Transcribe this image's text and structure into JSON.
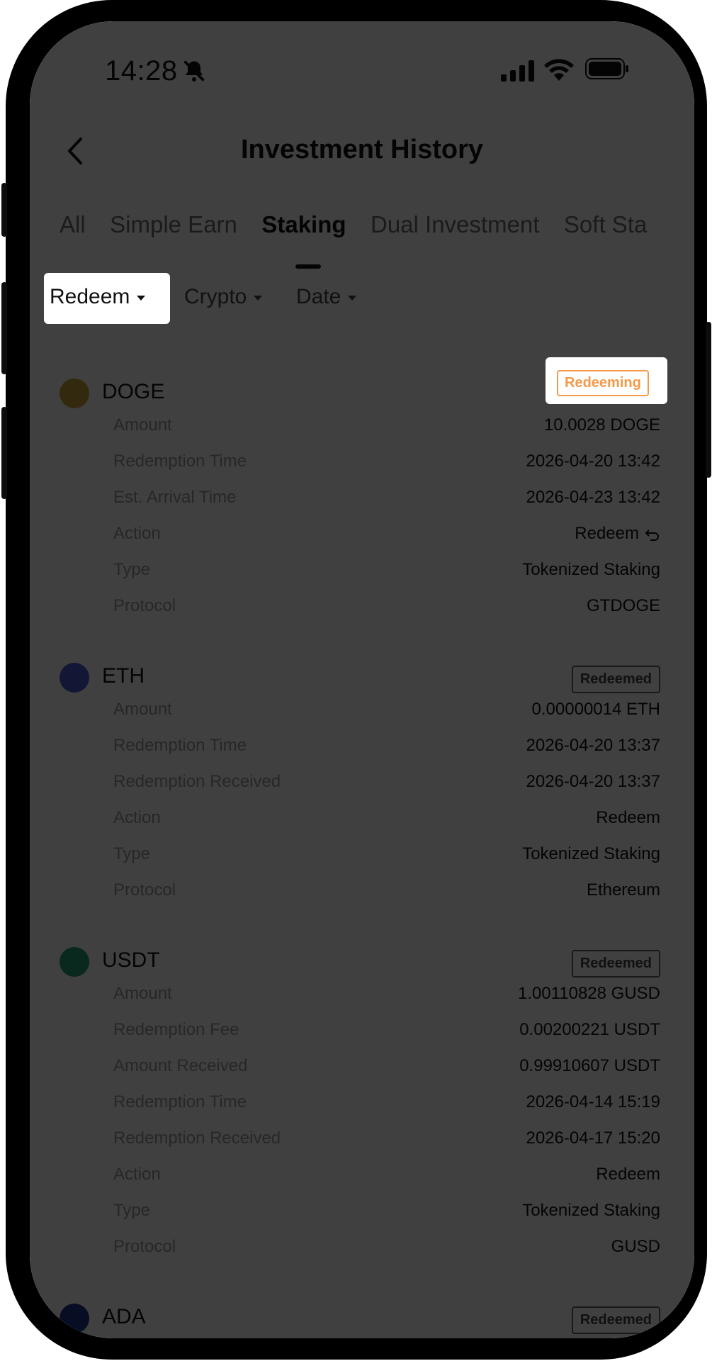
{
  "status_bar": {
    "time": "14:28"
  },
  "header": {
    "title": "Investment History"
  },
  "tabs": [
    {
      "label": "All"
    },
    {
      "label": "Simple Earn"
    },
    {
      "label": "Staking",
      "active": true
    },
    {
      "label": "Dual Investment"
    },
    {
      "label": "Soft Sta"
    }
  ],
  "filters": {
    "type": "Redeem",
    "crypto": "Crypto",
    "date": "Date"
  },
  "records": [
    {
      "coin": "DOGE",
      "status": "Redeeming",
      "rows": [
        {
          "label": "Amount",
          "value": "10.0028 DOGE"
        },
        {
          "label": "Redemption Time",
          "value": "2026-04-20 13:42"
        },
        {
          "label": "Est. Arrival Time",
          "value": "2026-04-23 13:42"
        },
        {
          "label": "Action",
          "value": "Redeem"
        },
        {
          "label": "Type",
          "value": "Tokenized Staking"
        },
        {
          "label": "Protocol",
          "value": "GTDOGE"
        }
      ]
    },
    {
      "coin": "ETH",
      "status": "Redeemed",
      "rows": [
        {
          "label": "Amount",
          "value": "0.00000014 ETH"
        },
        {
          "label": "Redemption Time",
          "value": "2026-04-20 13:37"
        },
        {
          "label": "Redemption Received",
          "value": "2026-04-20 13:37"
        },
        {
          "label": "Action",
          "value": "Redeem"
        },
        {
          "label": "Type",
          "value": "Tokenized Staking"
        },
        {
          "label": "Protocol",
          "value": "Ethereum"
        }
      ]
    },
    {
      "coin": "USDT",
      "status": "Redeemed",
      "rows": [
        {
          "label": "Amount",
          "value": "1.00110828 GUSD"
        },
        {
          "label": "Redemption Fee",
          "value": "0.00200221 USDT"
        },
        {
          "label": "Amount Received",
          "value": "0.99910607 USDT"
        },
        {
          "label": "Redemption Time",
          "value": "2026-04-14 15:19"
        },
        {
          "label": "Redemption Received",
          "value": "2026-04-17 15:20"
        },
        {
          "label": "Action",
          "value": "Redeem"
        },
        {
          "label": "Type",
          "value": "Tokenized Staking"
        },
        {
          "label": "Protocol",
          "value": "GUSD"
        }
      ]
    },
    {
      "coin": "ADA",
      "status": "Redeemed",
      "rows": []
    }
  ],
  "colors": {
    "accent_orange": "#f39a4a",
    "overlay": "rgba(0,0,0,0.75)"
  }
}
